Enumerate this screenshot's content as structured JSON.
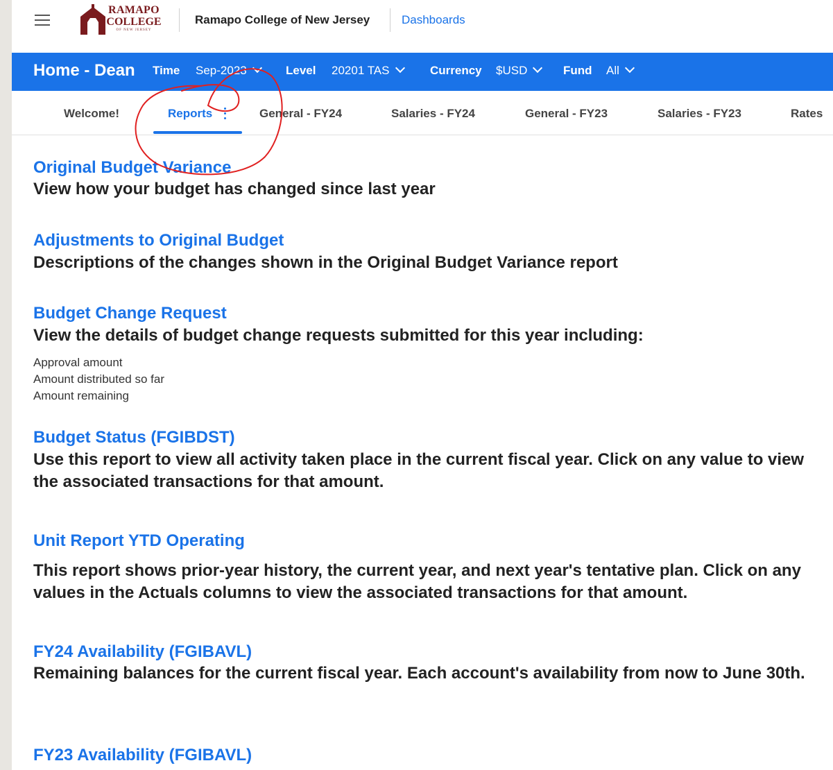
{
  "topbar": {
    "logo_line1": "RAMAPO",
    "logo_line2": "COLLEGE",
    "logo_line3": "OF NEW JERSEY",
    "org_name": "Ramapo College of New Jersey",
    "dashboards_link": "Dashboards",
    "menu_icon": "hamburger-icon"
  },
  "header": {
    "title": "Home - Dean",
    "filters": [
      {
        "label": "Time",
        "value": "Sep-2023"
      },
      {
        "label": "Level",
        "value": "20201 TAS"
      },
      {
        "label": "Currency",
        "value": "$USD"
      },
      {
        "label": "Fund",
        "value": "All"
      }
    ]
  },
  "tabs": {
    "items": [
      "Welcome!",
      "Reports",
      "General - FY24",
      "Salaries - FY24",
      "General - FY23",
      "Salaries - FY23",
      "Rates"
    ],
    "active": "Reports"
  },
  "reports": [
    {
      "title": "Original Budget Variance",
      "desc": "View how your budget has changed since last year"
    },
    {
      "title": "Adjustments to Original Budget",
      "desc": "Descriptions of the changes shown in the Original Budget Variance report"
    },
    {
      "title": "Budget Change Request",
      "desc": "View the details of budget change requests submitted for this year including:",
      "details": [
        "Approval amount",
        "Amount distributed so far",
        "Amount remaining"
      ]
    },
    {
      "title": "Budget Status (FGIBDST)",
      "desc": "Use this report to view all activity taken place in the current fiscal year. Click on any value to view the associated transactions for that amount."
    },
    {
      "title": "Unit Report YTD Operating",
      "desc": "This report shows prior-year history, the current year, and next year's tentative plan. Click on any values in the Actuals columns to view the associated transactions for that amount."
    },
    {
      "title": "FY24 Availability (FGIBAVL)",
      "desc": "Remaining balances for the current fiscal year. Each account's availability from now to June 30th."
    },
    {
      "title": "FY23 Availability (FGIBAVL)"
    }
  ],
  "colors": {
    "accent": "#1a73e8",
    "logo": "#7a1b1e",
    "annotation": "#e02020"
  }
}
